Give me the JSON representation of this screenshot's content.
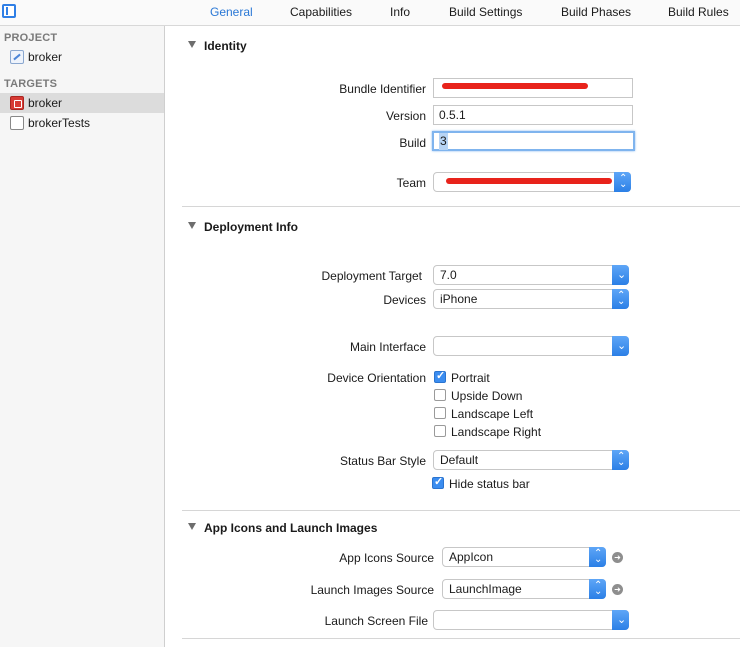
{
  "tabs": [
    {
      "label": "General",
      "active": true
    },
    {
      "label": "Capabilities"
    },
    {
      "label": "Info"
    },
    {
      "label": "Build Settings"
    },
    {
      "label": "Build Phases"
    },
    {
      "label": "Build Rules"
    }
  ],
  "sidebar": {
    "project_header": "PROJECT",
    "project_item": "broker",
    "targets_header": "TARGETS",
    "targets": [
      {
        "label": "broker",
        "selected": true
      },
      {
        "label": "brokerTests"
      }
    ]
  },
  "identity": {
    "header": "Identity",
    "bundle_identifier_label": "Bundle Identifier",
    "bundle_identifier_value": "",
    "version_label": "Version",
    "version_value": "0.5.1",
    "build_label": "Build",
    "build_value": "3",
    "team_label": "Team",
    "team_value": ""
  },
  "deployment": {
    "header": "Deployment Info",
    "target_label": "Deployment Target",
    "target_value": "7.0",
    "devices_label": "Devices",
    "devices_value": "iPhone",
    "main_interface_label": "Main Interface",
    "main_interface_value": "",
    "orientation_label": "Device Orientation",
    "orientations": [
      {
        "label": "Portrait",
        "checked": true
      },
      {
        "label": "Upside Down",
        "checked": false
      },
      {
        "label": "Landscape Left",
        "checked": false
      },
      {
        "label": "Landscape Right",
        "checked": false
      }
    ],
    "status_bar_label": "Status Bar Style",
    "status_bar_value": "Default",
    "hide_status_bar_label": "Hide status bar",
    "hide_status_bar_checked": true
  },
  "app_icons": {
    "header": "App Icons and Launch Images",
    "icons_source_label": "App Icons Source",
    "icons_source_value": "AppIcon",
    "launch_images_label": "Launch Images Source",
    "launch_images_value": "LaunchImage",
    "launch_screen_label": "Launch Screen File",
    "launch_screen_value": ""
  },
  "colors": {
    "accent": "#2b7fe6",
    "active_tab": "#2a78d6",
    "redaction": "#e8231b"
  }
}
